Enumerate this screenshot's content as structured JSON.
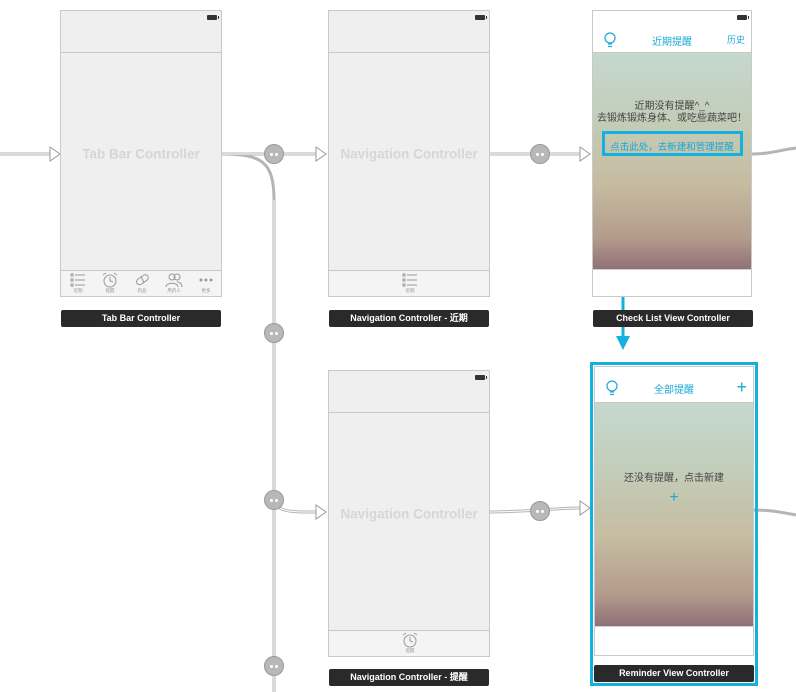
{
  "scenes": {
    "tabbar": {
      "watermark": "Tab Bar Controller",
      "label": "Tab Bar Controller",
      "tabs": [
        "近期",
        "提醒",
        "药品",
        "用药人",
        "更多"
      ],
      "tab_icons": [
        "list-icon",
        "alarm-clock-icon",
        "pill-icon",
        "people-icon",
        "more-dots-icon"
      ]
    },
    "nav_recent": {
      "watermark": "Navigation Controller",
      "label": "Navigation Controller - 近期",
      "tab": "近期",
      "tab_icon": "list-icon"
    },
    "checklist": {
      "nav_title": "近期提醒",
      "nav_right": "历史",
      "left_icon": "lightbulb-icon",
      "empty_line1": "近期没有提醒^_^",
      "empty_line2": "去锻炼锻炼身体、或吃些蔬菜吧！",
      "link": "点击此处，去新建和管理提醒",
      "label": "Check List View Controller"
    },
    "nav_reminder": {
      "watermark": "Navigation Controller",
      "label": "Navigation Controller - 提醒",
      "tab": "提醒",
      "tab_icon": "alarm-clock-icon"
    },
    "reminder": {
      "nav_title": "全部提醒",
      "nav_right": "+",
      "left_icon": "lightbulb-icon",
      "empty_text": "还没有提醒，点击新建",
      "add": "+",
      "label": "Reminder View Controller"
    }
  },
  "colors": {
    "accent": "#14b1de",
    "link": "#1aa8d8",
    "label_bg": "#2a2a2a"
  }
}
